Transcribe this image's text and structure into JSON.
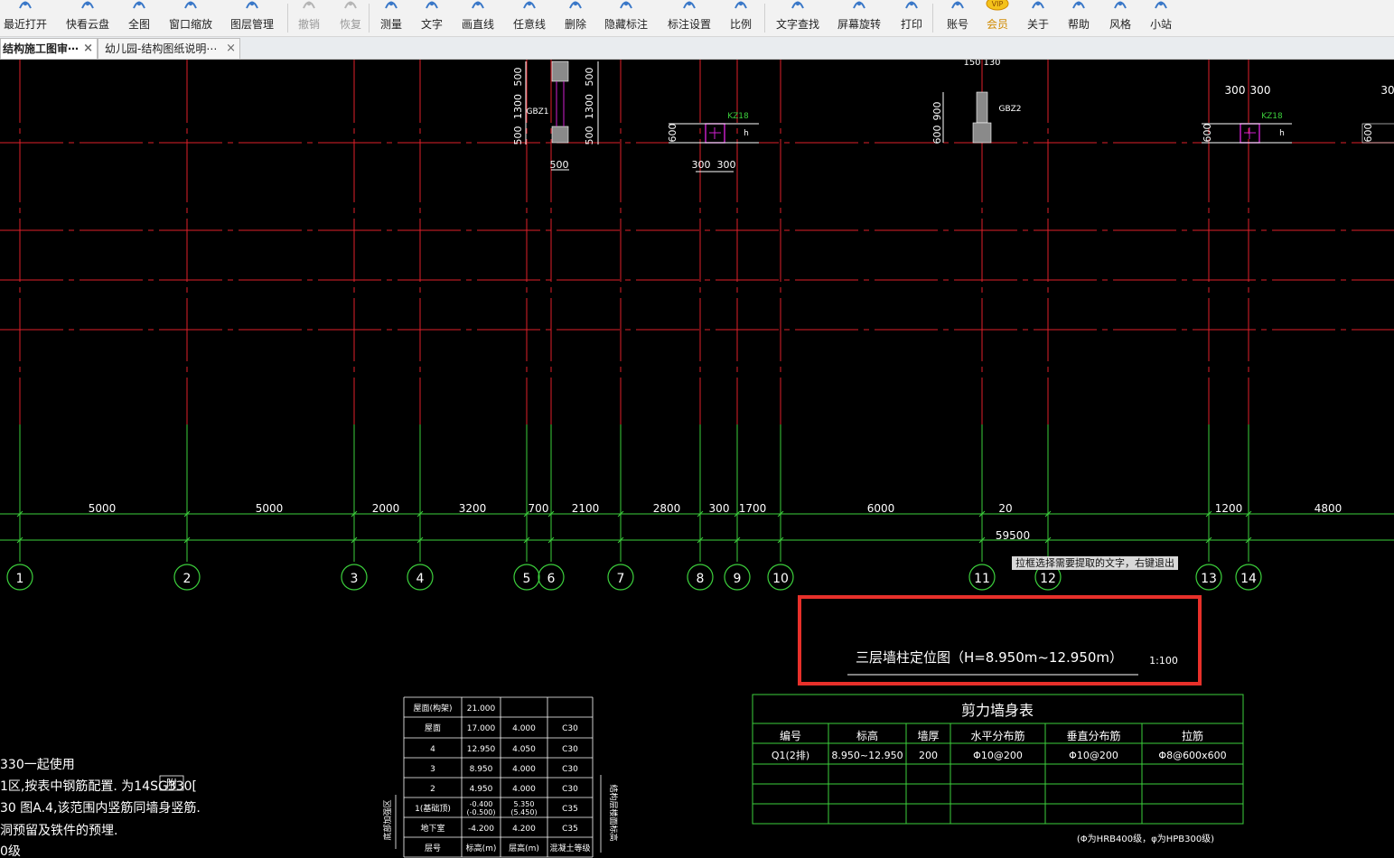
{
  "toolbar": {
    "items": [
      {
        "label": "最近打开",
        "icon": "history-icon",
        "enabled": true
      },
      {
        "label": "快看云盘",
        "icon": "cloud-icon",
        "enabled": true
      },
      {
        "label": "全图",
        "icon": "fullview-icon",
        "enabled": true
      },
      {
        "label": "窗口缩放",
        "icon": "zoom-window-icon",
        "enabled": true
      },
      {
        "label": "图层管理",
        "icon": "layers-icon",
        "enabled": true
      },
      {
        "label": "撤销",
        "icon": "undo-icon",
        "enabled": false
      },
      {
        "label": "恢复",
        "icon": "redo-icon",
        "enabled": false
      },
      {
        "label": "测量",
        "icon": "measure-icon",
        "enabled": true
      },
      {
        "label": "文字",
        "icon": "text-icon",
        "enabled": true
      },
      {
        "label": "画直线",
        "icon": "line-icon",
        "enabled": true
      },
      {
        "label": "任意线",
        "icon": "freeline-icon",
        "enabled": true
      },
      {
        "label": "删除",
        "icon": "eraser-icon",
        "enabled": true
      },
      {
        "label": "隐藏标注",
        "icon": "eye-icon",
        "enabled": true
      },
      {
        "label": "标注设置",
        "icon": "gear-icon",
        "enabled": true
      },
      {
        "label": "比例",
        "icon": "scale-icon",
        "enabled": true
      },
      {
        "label": "文字查找",
        "icon": "text-search-icon",
        "enabled": true
      },
      {
        "label": "屏幕旋转",
        "icon": "rotate-icon",
        "enabled": true
      },
      {
        "label": "打印",
        "icon": "printer-icon",
        "enabled": true
      },
      {
        "label": "账号",
        "icon": "user-icon",
        "enabled": true
      },
      {
        "label": "会员",
        "icon": "vip-icon",
        "enabled": true
      },
      {
        "label": "关于",
        "icon": "info-icon",
        "enabled": true
      },
      {
        "label": "帮助",
        "icon": "help-icon",
        "enabled": true
      },
      {
        "label": "风格",
        "icon": "style-icon",
        "enabled": true
      },
      {
        "label": "小站",
        "icon": "station-icon",
        "enabled": true
      }
    ],
    "vip_badge": "VIP"
  },
  "tabs": [
    {
      "label": "结构施工图审⋯",
      "close": "×",
      "active": true
    },
    {
      "label": "幼儿园-结构图纸说明⋯",
      "close": "×",
      "active": false
    }
  ],
  "drawing": {
    "grid_axes": [
      "1",
      "2",
      "3",
      "4",
      "5",
      "6",
      "7",
      "8",
      "9",
      "10",
      "11",
      "12",
      "13",
      "14"
    ],
    "segment_dims": [
      "5000",
      "5000",
      "2000",
      "3200",
      "700",
      "2100",
      "2800",
      "300",
      "1700",
      "6000",
      "20",
      "1200",
      "4800"
    ],
    "total_dim": "59500",
    "detail_labels": {
      "gbz1": "GBZ1",
      "gbz2": "GBZ2",
      "kz18": "KZ18",
      "h": "h",
      "dim_500": "500",
      "dim_1300": "1300",
      "dim_600": "600",
      "dim_900": "900",
      "dim_300": "300",
      "dim_30": "30",
      "dim_150": "150",
      "dim_130": "130"
    },
    "plan_title": "三层墙柱定位图（H=8.950m~12.950m）",
    "plan_scale": "1:100",
    "floor_table": {
      "rows": [
        [
          "屋面(构架)",
          "21.000",
          "",
          ""
        ],
        [
          "屋面",
          "17.000",
          "4.000",
          "C30"
        ],
        [
          "4",
          "12.950",
          "4.050",
          "C30"
        ],
        [
          "3",
          "8.950",
          "4.000",
          "C30"
        ],
        [
          "2",
          "4.950",
          "4.000",
          "C30"
        ],
        [
          "1(基础顶)",
          "-0.400\n(-0.500)",
          "5.350\n(5.450)",
          "C35"
        ],
        [
          "地下室",
          "-4.200",
          "4.200",
          "C35"
        ],
        [
          "层号",
          "标高(m)",
          "层高(m)",
          "混凝土等级"
        ]
      ],
      "side_label_left": "底部加强区",
      "side_label_right": "结构层楼面标高"
    },
    "wall_table": {
      "title": "剪力墙身表",
      "headers": [
        "编号",
        "标高",
        "墙厚",
        "水平分布筋",
        "垂直分布筋",
        "拉筋"
      ],
      "rows": [
        [
          "Q1(2排)",
          "8.950~12.950",
          "200",
          "Φ10@200",
          "Φ10@200",
          "Φ8@600x600"
        ]
      ],
      "note": "(Φ为HRB400级，φ为HPB300级)"
    },
    "notes": [
      "330一起使用",
      "1区,按表中钢筋配置.   为14SG330[",
      "30 图A.4,该范围内竖筋同墙身竖筋.",
      "洞预留及铁件的预埋.",
      "0级"
    ],
    "note_box": "附"
  },
  "tooltip": "拉框选择需要提取的文字，右键退出",
  "colors": {
    "background": "#000000",
    "grid_red": "#e0202a",
    "grid_green": "#3ccf3c",
    "text_white": "#ffffff",
    "magenta": "#d020d0",
    "highlight": "#e8302a",
    "gray_fill": "#8a8a8a"
  }
}
